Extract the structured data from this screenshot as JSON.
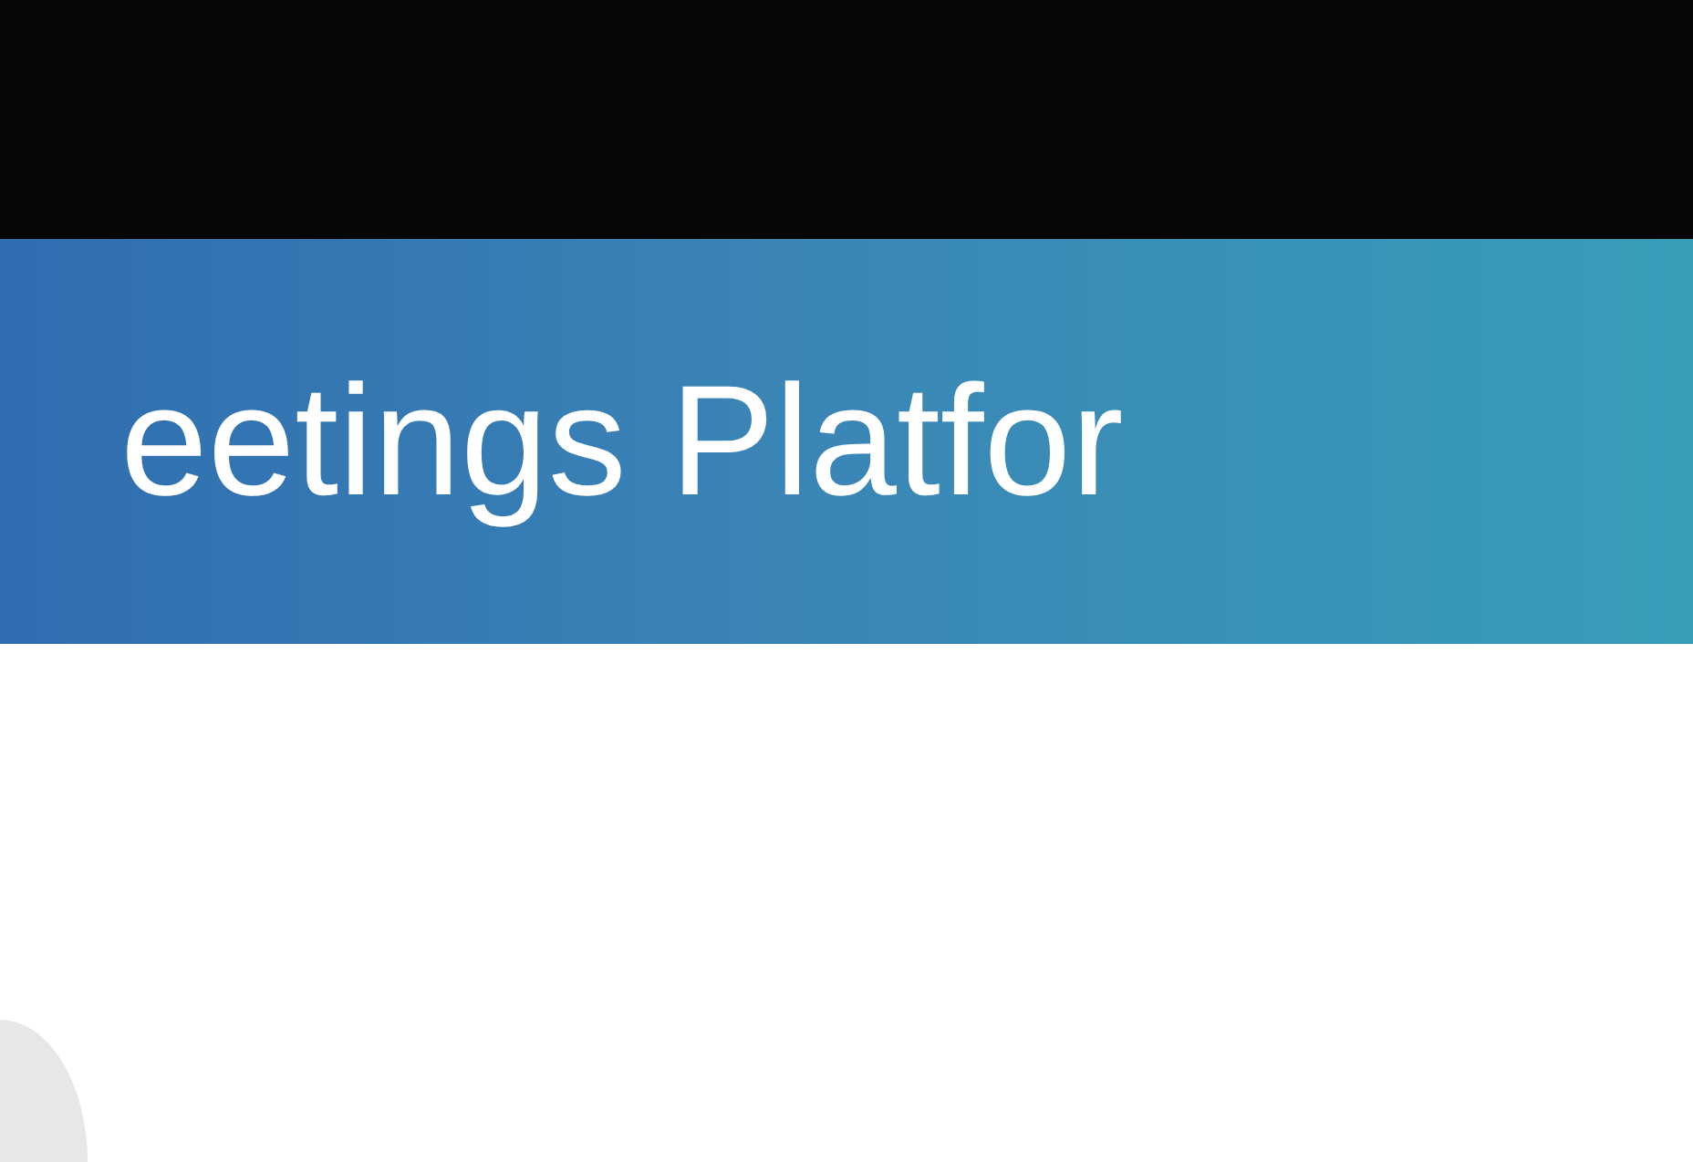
{
  "banner": {
    "title": "eetings Platfor"
  }
}
